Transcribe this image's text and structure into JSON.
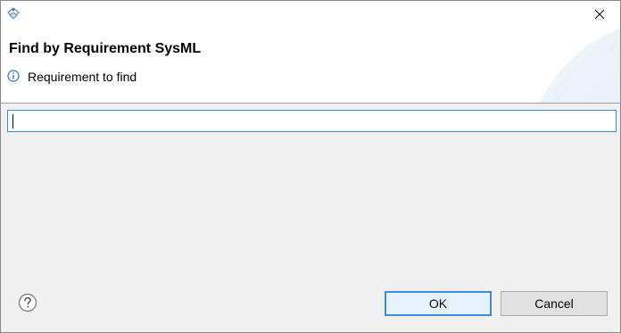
{
  "window": {
    "icon": "dialog-app-icon",
    "close_icon": "close-icon"
  },
  "header": {
    "title": "Find by Requirement SysML",
    "message": "Requirement to find",
    "message_icon": "info-icon"
  },
  "search": {
    "value": "",
    "placeholder": ""
  },
  "footer": {
    "help_icon": "help-icon",
    "ok_label": "OK",
    "cancel_label": "Cancel"
  },
  "colors": {
    "focus_accent": "#3c8dd6",
    "dialog_background": "#f0f0f0",
    "header_background": "#ffffff"
  }
}
